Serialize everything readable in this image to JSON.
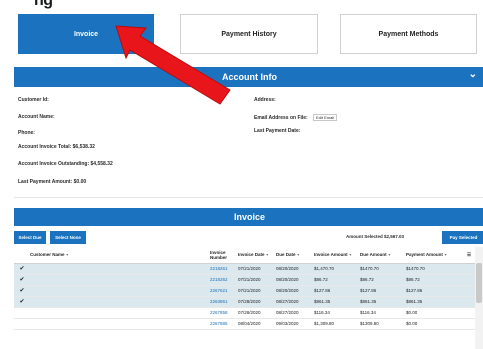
{
  "header_partial": "ng",
  "tabs": [
    {
      "label": "Invoice",
      "active": true
    },
    {
      "label": "Payment History",
      "active": false
    },
    {
      "label": "Payment Methods",
      "active": false
    }
  ],
  "account_info": {
    "title": "Account Info",
    "customer_id_label": "Customer Id:",
    "account_name_label": "Account Name:",
    "phone_label": "Phone:",
    "invoice_total": "Account Invoice Total: $6,538.32",
    "invoice_outstanding": "Account Invoice Outstanding: $4,558.32",
    "last_payment_amount": "Last Payment Amount: $0.00",
    "address_label": "Address:",
    "email_label": "Email Address on File:",
    "edit_email_label": "Edit Email",
    "last_payment_date_label": "Last Payment Date:"
  },
  "invoice": {
    "title": "Invoice",
    "select_due_label": "Select Due",
    "select_none_label": "Select None",
    "amount_selected": "Amount Selected $2,567.03",
    "pay_selected_label": "Pay Selected",
    "columns": [
      "Customer Name",
      "Invoice Number",
      "Invoice Date",
      "Due Date",
      "Invoice Amount",
      "Due Amount",
      "Payment Amount"
    ],
    "rows": [
      {
        "checked": true,
        "customer": "",
        "number": "2218261",
        "invoice_date": "07/21/2020",
        "due_date": "08/20/2020",
        "invoice_amount": "$1,470.70",
        "due_amount": "$1470.70",
        "payment_amount": "$1470.70"
      },
      {
        "checked": true,
        "customer": "",
        "number": "2218262",
        "invoice_date": "07/21/2020",
        "due_date": "08/20/2020",
        "invoice_amount": "$86.72",
        "due_amount": "$86.72",
        "payment_amount": "$86.72"
      },
      {
        "checked": true,
        "customer": "",
        "number": "2267621",
        "invoice_date": "07/21/2020",
        "due_date": "08/20/2020",
        "invoice_amount": "$127.86",
        "due_amount": "$127.86",
        "payment_amount": "$127.86"
      },
      {
        "checked": true,
        "customer": "",
        "number": "2263861",
        "invoice_date": "07/28/2020",
        "due_date": "08/27/2020",
        "invoice_amount": "$861.35",
        "due_amount": "$861.35",
        "payment_amount": "$861.35"
      },
      {
        "checked": false,
        "customer": "",
        "number": "2267858",
        "invoice_date": "07/28/2020",
        "due_date": "08/27/2020",
        "invoice_amount": "$116.34",
        "due_amount": "$116.34",
        "payment_amount": "$0.00"
      },
      {
        "checked": false,
        "customer": "",
        "number": "2267885",
        "invoice_date": "08/04/2020",
        "due_date": "09/03/2020",
        "invoice_amount": "$1,309.80",
        "due_amount": "$1309.80",
        "payment_amount": "$0.00"
      }
    ]
  },
  "colors": {
    "brand": "#1b73c0",
    "selected_row": "#dbe9ef",
    "arrow": "#e8161b"
  },
  "icons": {
    "collapse": "chevron-down-icon",
    "check": "checkmark-icon",
    "column_menu": "column-menu-icon"
  }
}
